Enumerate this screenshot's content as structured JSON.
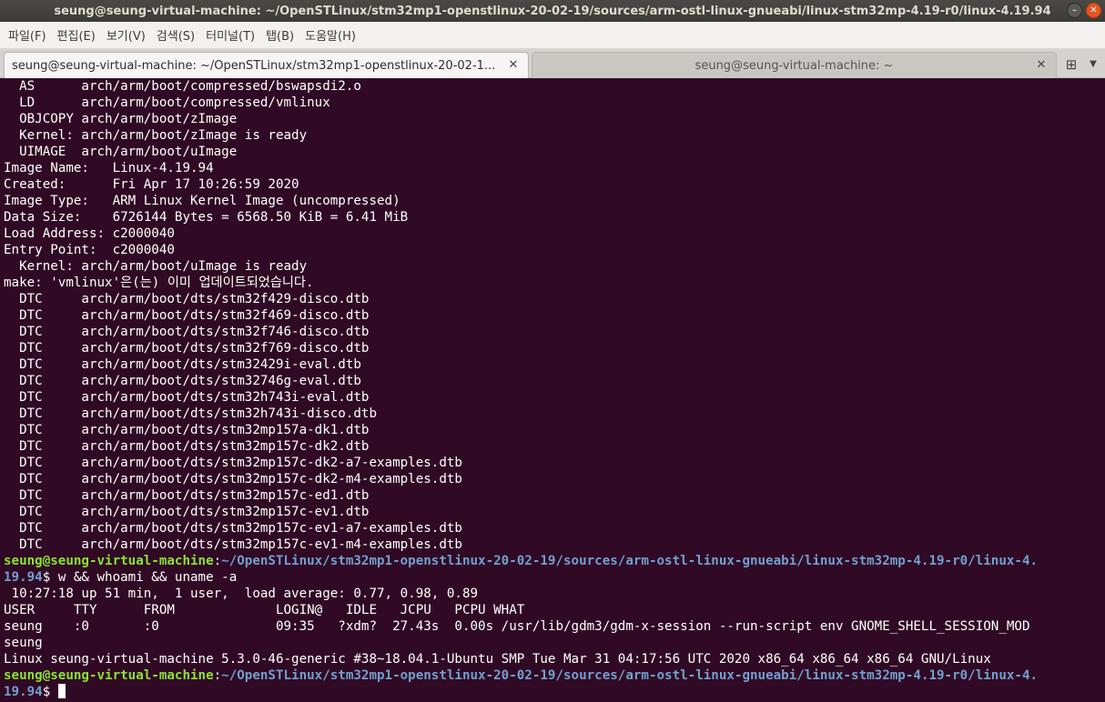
{
  "window": {
    "title": "seung@seung-virtual-machine: ~/OpenSTLinux/stm32mp1-openstlinux-20-02-19/sources/arm-ostl-linux-gnueabi/linux-stm32mp-4.19-r0/linux-4.19.94",
    "minimize_glyph": "–",
    "close_glyph": "✕"
  },
  "menu": [
    {
      "name": "file",
      "label": "파일(F)"
    },
    {
      "name": "edit",
      "label": "편집(E)"
    },
    {
      "name": "view",
      "label": "보기(V)"
    },
    {
      "name": "search",
      "label": "검색(S)"
    },
    {
      "name": "terminal",
      "label": "터미널(T)"
    },
    {
      "name": "tabs",
      "label": "탭(B)"
    },
    {
      "name": "help",
      "label": "도움말(H)"
    }
  ],
  "tabs": {
    "active_label": "seung@seung-virtual-machine: ~/OpenSTLinux/stm32mp1-openstlinux-20-02-1...",
    "inactive_label": "seung@seung-virtual-machine: ~",
    "close_glyph": "✕",
    "new_tab_glyph": "⊞",
    "menu_glyph": "▼"
  },
  "terminal": {
    "output_lines": [
      "  AS      arch/arm/boot/compressed/bswapsdi2.o",
      "  LD      arch/arm/boot/compressed/vmlinux",
      "  OBJCOPY arch/arm/boot/zImage",
      "  Kernel: arch/arm/boot/zImage is ready",
      "  UIMAGE  arch/arm/boot/uImage",
      "Image Name:   Linux-4.19.94",
      "Created:      Fri Apr 17 10:26:59 2020",
      "Image Type:   ARM Linux Kernel Image (uncompressed)",
      "Data Size:    6726144 Bytes = 6568.50 KiB = 6.41 MiB",
      "Load Address: c2000040",
      "Entry Point:  c2000040",
      "  Kernel: arch/arm/boot/uImage is ready",
      "make: 'vmlinux'은(는) 이미 업데이트되었습니다.",
      "  DTC     arch/arm/boot/dts/stm32f429-disco.dtb",
      "  DTC     arch/arm/boot/dts/stm32f469-disco.dtb",
      "  DTC     arch/arm/boot/dts/stm32f746-disco.dtb",
      "  DTC     arch/arm/boot/dts/stm32f769-disco.dtb",
      "  DTC     arch/arm/boot/dts/stm32429i-eval.dtb",
      "  DTC     arch/arm/boot/dts/stm32746g-eval.dtb",
      "  DTC     arch/arm/boot/dts/stm32h743i-eval.dtb",
      "  DTC     arch/arm/boot/dts/stm32h743i-disco.dtb",
      "  DTC     arch/arm/boot/dts/stm32mp157a-dk1.dtb",
      "  DTC     arch/arm/boot/dts/stm32mp157c-dk2.dtb",
      "  DTC     arch/arm/boot/dts/stm32mp157c-dk2-a7-examples.dtb",
      "  DTC     arch/arm/boot/dts/stm32mp157c-dk2-m4-examples.dtb",
      "  DTC     arch/arm/boot/dts/stm32mp157c-ed1.dtb",
      "  DTC     arch/arm/boot/dts/stm32mp157c-ev1.dtb",
      "  DTC     arch/arm/boot/dts/stm32mp157c-ev1-a7-examples.dtb",
      "  DTC     arch/arm/boot/dts/stm32mp157c-ev1-m4-examples.dtb"
    ],
    "prompt1": {
      "user": "seung@seung-virtual-machine",
      "sep": ":",
      "path_line1": "~/OpenSTLinux/stm32mp1-openstlinux-20-02-19/sources/arm-ostl-linux-gnueabi/linux-stm32mp-4.19-r0/linux-4.",
      "path_line2": "19.94",
      "dollar": "$ ",
      "command": "w && whoami && uname -a"
    },
    "result_lines": [
      " 10:27:18 up 51 min,  1 user,  load average: 0.77, 0.98, 0.89",
      "USER     TTY      FROM             LOGIN@   IDLE   JCPU   PCPU WHAT",
      "seung    :0       :0               09:35   ?xdm?  27.43s  0.00s /usr/lib/gdm3/gdm-x-session --run-script env GNOME_SHELL_SESSION_MOD",
      "seung",
      "Linux seung-virtual-machine 5.3.0-46-generic #38~18.04.1-Ubuntu SMP Tue Mar 31 04:17:56 UTC 2020 x86_64 x86_64 x86_64 GNU/Linux"
    ],
    "prompt2": {
      "user": "seung@seung-virtual-machine",
      "sep": ":",
      "path_line1": "~/OpenSTLinux/stm32mp1-openstlinux-20-02-19/sources/arm-ostl-linux-gnueabi/linux-stm32mp-4.19-r0/linux-4.",
      "path_line2": "19.94",
      "dollar": "$ "
    }
  },
  "colors": {
    "terminal_bg": "#300a24",
    "prompt_user": "#8ae234",
    "prompt_path": "#729fcf",
    "close_button": "#e95420"
  }
}
